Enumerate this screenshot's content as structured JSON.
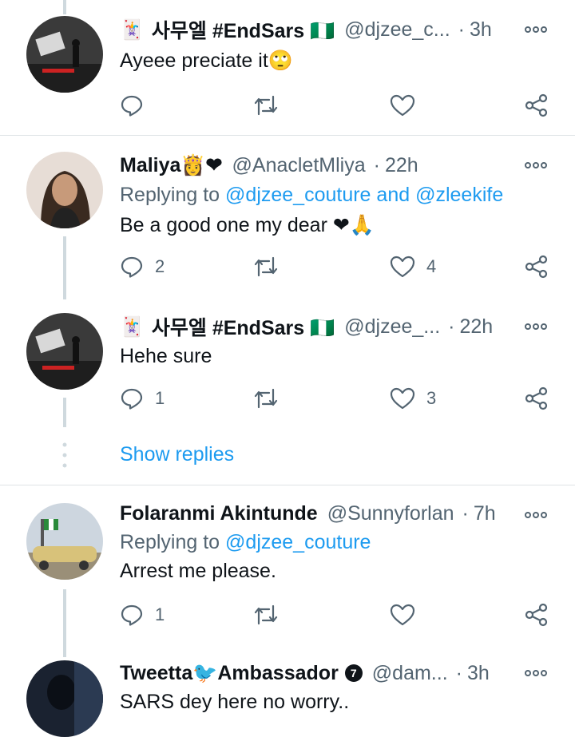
{
  "tweets": [
    {
      "emoji": "🃏",
      "name": "사무엘 #EndSars 🇳🇬",
      "handle": "@djzee_c...",
      "time": "3h",
      "text": "Ayeee preciate it🙄",
      "replies": "",
      "likes": ""
    },
    {
      "name": "Maliya👸❤",
      "handle": "@AnacletMliya",
      "time": "22h",
      "reply_prefix": "Replying to ",
      "mention1": "@djzee_couture",
      "and": " and ",
      "mention2": "@zleekife",
      "text": "Be a good one my dear ❤🙏",
      "replies": "2",
      "likes": "4"
    },
    {
      "emoji": "🃏",
      "name": "사무엘 #EndSars 🇳🇬",
      "handle": "@djzee_...",
      "time": "22h",
      "text": "Hehe sure",
      "replies": "1",
      "likes": "3"
    },
    {
      "name": "Folaranmi Akintunde",
      "handle": "@Sunnyforlan",
      "time": "7h",
      "reply_prefix": "Replying to ",
      "mention1": "@djzee_couture",
      "text": "Arrest me please.",
      "replies": "1",
      "likes": ""
    },
    {
      "name": "Tweetta🐦Ambassador",
      "badge": "7",
      "handle": "@dam...",
      "time": "3h",
      "text": "SARS dey here no worry.."
    }
  ],
  "show_replies": "Show replies",
  "colors": {
    "accent": "#1d9bf0",
    "secondary": "#536471",
    "line": "#cfd9de"
  }
}
